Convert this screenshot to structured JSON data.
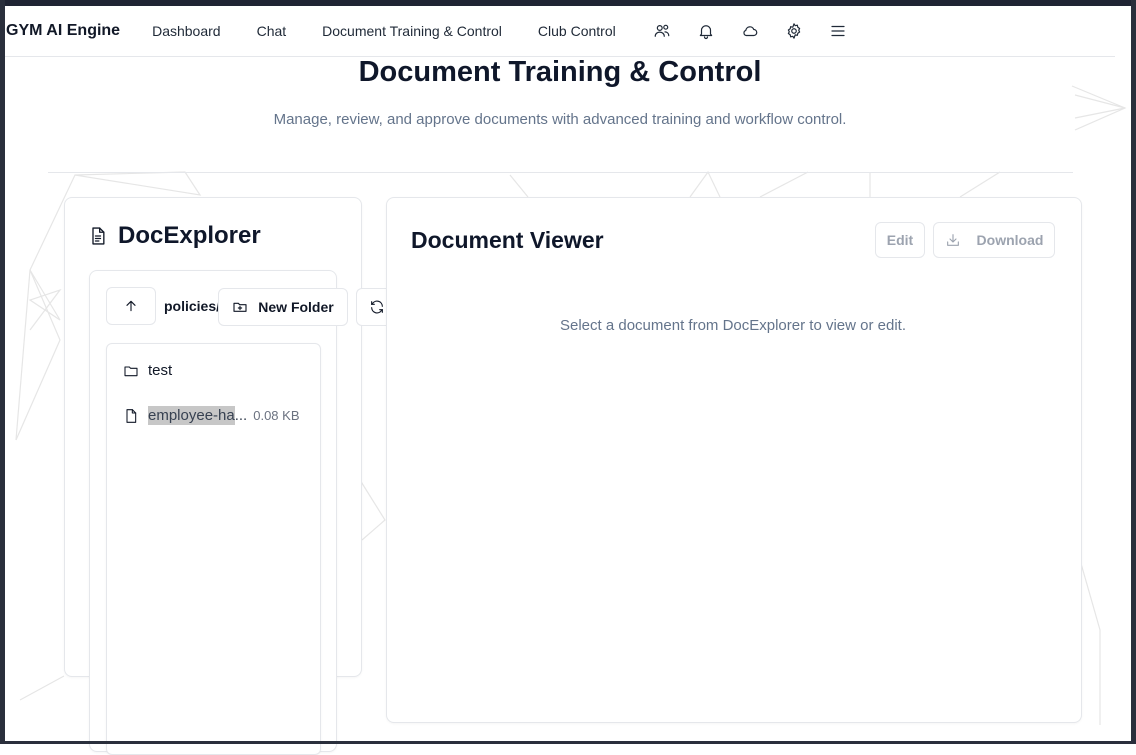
{
  "nav": {
    "brand": "GYM AI Engine",
    "links": [
      "Dashboard",
      "Chat",
      "Document Training & Control",
      "Club Control"
    ],
    "icons": [
      "users-icon",
      "bell-icon",
      "cloud-icon",
      "gear-icon",
      "menu-icon"
    ]
  },
  "header": {
    "title": "Document Training & Control",
    "subtitle": "Manage, review, and approve documents with advanced training and workflow control."
  },
  "explorer": {
    "title": "DocExplorer",
    "path": "policies/",
    "new_folder_label": "New Folder",
    "items": [
      {
        "type": "folder",
        "name": "test"
      },
      {
        "type": "file",
        "name": "employee-ha",
        "ellipsis": "...",
        "size": "0.08 KB"
      }
    ]
  },
  "viewer": {
    "title": "Document Viewer",
    "edit_label": "Edit",
    "download_label": "Download",
    "empty_message": "Select a document from DocExplorer to view or edit."
  },
  "colors": {
    "frame": "#2a2f3c",
    "text_primary": "#0f172a",
    "text_muted": "#64748b",
    "border": "#e5e7eb",
    "selection": "#c7c7c7"
  }
}
